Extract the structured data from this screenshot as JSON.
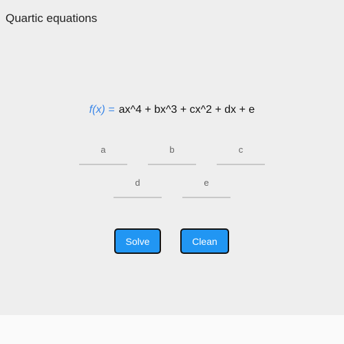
{
  "app": {
    "title": "Quartic equations"
  },
  "equation": {
    "fx_label": "f(x) =",
    "expression": "ax^4 + bx^3 + cx^2 + dx + e"
  },
  "coefficients": {
    "a": {
      "label": "a",
      "value": ""
    },
    "b": {
      "label": "b",
      "value": ""
    },
    "c": {
      "label": "c",
      "value": ""
    },
    "d": {
      "label": "d",
      "value": ""
    },
    "e": {
      "label": "e",
      "value": ""
    }
  },
  "actions": {
    "solve_label": "Solve",
    "clean_label": "Clean"
  },
  "colors": {
    "background": "#eeeeee",
    "accent": "#2196f3",
    "fx_color": "#3a86e8"
  }
}
